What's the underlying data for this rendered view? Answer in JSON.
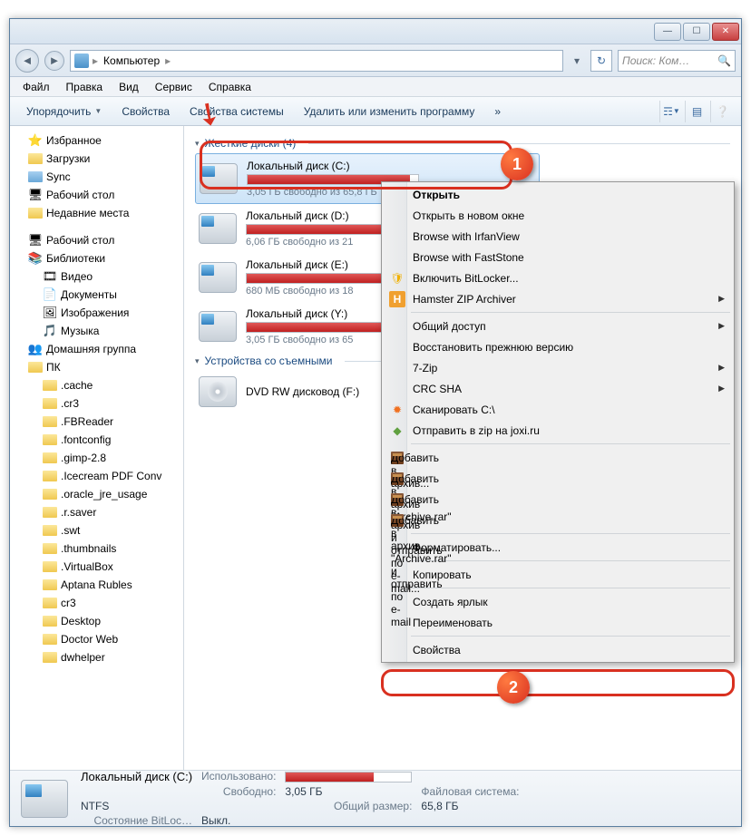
{
  "titlebar": {
    "min": "—",
    "max": "☐",
    "close": "✕"
  },
  "address": {
    "root": "Компьютер",
    "sep": "▸",
    "search_placeholder": "Поиск: Ком…"
  },
  "menubar": [
    "Файл",
    "Правка",
    "Вид",
    "Сервис",
    "Справка"
  ],
  "toolbar": {
    "organize": "Упорядочить",
    "props": "Свойства",
    "sysprops": "Свойства системы",
    "uninstall": "Удалить или изменить программу",
    "more": "»"
  },
  "tree": {
    "favorites": {
      "label": "Избранное",
      "items": [
        "Загрузки",
        "Sync",
        "Рабочий стол",
        "Недавние места"
      ]
    },
    "desktop": {
      "label": "Рабочий стол",
      "libraries": {
        "label": "Библиотеки",
        "items": [
          "Видео",
          "Документы",
          "Изображения",
          "Музыка"
        ]
      },
      "homegroup": "Домашняя группа",
      "pc": {
        "label": "ПК",
        "items": [
          ".cache",
          ".cr3",
          ".FBReader",
          ".fontconfig",
          ".gimp-2.8",
          ".Icecream PDF Conv",
          ".oracle_jre_usage",
          ".r.saver",
          ".swt",
          ".thumbnails",
          ".VirtualBox",
          "Aptana Rubles",
          "cr3",
          "Desktop",
          "Doctor Web",
          "dwhelper"
        ]
      }
    }
  },
  "content": {
    "hdd_header": "Жесткие диски (4)",
    "removable_header": "Устройства со съемными",
    "drives": [
      {
        "name": "Локальный диск (C:)",
        "free": "3,05 ГБ свободно из 65,8 ГБ",
        "fill": 95,
        "selected": true
      },
      {
        "name": "Локальный диск (D:)",
        "free": "6,06 ГБ свободно из 21",
        "fill": 80
      },
      {
        "name": "Локальный диск (E:)",
        "free": "680 МБ свободно из 18",
        "fill": 96
      },
      {
        "name": "Локальный диск (Y:)",
        "free": "3,05 ГБ свободно из 65",
        "fill": 95
      }
    ],
    "dvd": "DVD RW дисковод (F:)"
  },
  "context_menu": [
    {
      "label": "Открыть",
      "bold": true
    },
    {
      "label": "Открыть в новом окне"
    },
    {
      "label": "Browse with IrfanView"
    },
    {
      "label": "Browse with FastStone"
    },
    {
      "label": "Включить BitLocker...",
      "icon": "shield"
    },
    {
      "label": "Hamster ZIP Archiver",
      "icon": "H",
      "submenu": true
    },
    {
      "sep": true
    },
    {
      "label": "Общий доступ",
      "submenu": true
    },
    {
      "label": "Восстановить прежнюю версию"
    },
    {
      "label": "7-Zip",
      "submenu": true
    },
    {
      "label": "CRC SHA",
      "submenu": true
    },
    {
      "label": "Сканировать C:\\",
      "icon": "av"
    },
    {
      "label": "Отправить в zip на joxi.ru",
      "icon": "jx"
    },
    {
      "sep": true
    },
    {
      "label": "Добавить в архив...",
      "icon": "rar"
    },
    {
      "label": "Добавить в архив \"Archive.rar\"",
      "icon": "rar"
    },
    {
      "label": "Добавить в архив и отправить по e-mail...",
      "icon": "rar"
    },
    {
      "label": "Добавить в архив \"Archive.rar\" и отправить по e-mail",
      "icon": "rar"
    },
    {
      "sep": true
    },
    {
      "label": "Форматировать..."
    },
    {
      "sep": true
    },
    {
      "label": "Копировать"
    },
    {
      "sep": true
    },
    {
      "label": "Создать ярлык"
    },
    {
      "label": "Переименовать"
    },
    {
      "sep": true
    },
    {
      "label": "Свойства",
      "highlight": true
    }
  ],
  "details": {
    "title": "Локальный диск (C:)",
    "used_lbl": "Использовано:",
    "free_lbl": "Свободно:",
    "free_val": "3,05 ГБ",
    "total_lbl": "Общий размер:",
    "total_val": "65,8 ГБ",
    "fs_lbl": "Файловая система:",
    "fs_val": "NTFS",
    "bl_lbl": "Состояние BitLoc…",
    "bl_val": "Выкл."
  },
  "annotations": {
    "a1": "1",
    "a2": "2"
  }
}
